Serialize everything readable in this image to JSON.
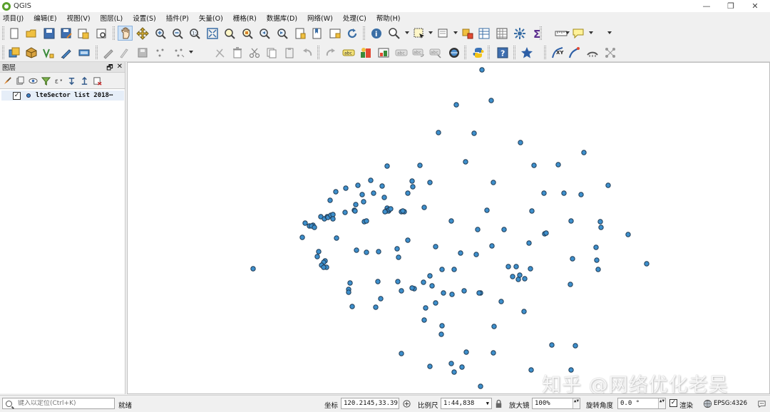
{
  "window": {
    "title": "QGIS",
    "controls": [
      "—",
      "❐",
      "✕"
    ]
  },
  "menubar": [
    "项目(J)",
    "编辑(E)",
    "视图(V)",
    "图层(L)",
    "设置(S)",
    "插件(P)",
    "矢量(O)",
    "栅格(R)",
    "数据库(D)",
    "网络(W)",
    "处理(C)",
    "帮助(H)"
  ],
  "toolbar1": {
    "icons": [
      "new-project-icon",
      "open-project-icon",
      "save-project-icon",
      "save-as-icon",
      "print-layout-icon",
      "layout-manager-icon",
      "pan-icon",
      "pan-to-selection-icon",
      "zoom-in-icon",
      "zoom-out-icon",
      "zoom-native-icon",
      "zoom-full-icon",
      "zoom-to-selection-icon",
      "zoom-to-layer-icon",
      "zoom-last-icon",
      "zoom-next-icon",
      "new-bookmark-icon",
      "show-bookmarks-icon",
      "new-map-view-icon",
      "refresh-icon",
      "identify-icon",
      "select-by-location-icon",
      "select-features-icon",
      "deselect-icon",
      "open-attribute-table-icon",
      "field-calculator-icon",
      "processing-toolbox-icon",
      "statistics-icon",
      "measure-icon",
      "map-tips-icon",
      "text-annotation-icon"
    ]
  },
  "toolbar2": {
    "icons": [
      "data-source-manager-icon",
      "new-geopackage-icon",
      "new-shapefile-icon",
      "digitize-icon",
      "new-virtual-layer-icon",
      "current-edits-icon",
      "toggle-editing-icon",
      "save-edits-icon",
      "add-feature-icon",
      "vertex-tool-icon",
      "delete-selected-icon",
      "cut-features-icon",
      "copy-features-icon",
      "paste-features-icon",
      "undo-icon",
      "redo-icon",
      "label-toolbar-icon",
      "layer-diagram-icon",
      "pin-labels-icon",
      "highlight-labels-icon",
      "move-label-icon",
      "rotate-label-icon",
      "change-label-icon",
      "plugin-globe-icon",
      "python-console-icon",
      "help-icon",
      "favorites-star-icon",
      "xy-tool-icon",
      "curve-tool-icon",
      "ruler-icon",
      "topology-icon"
    ]
  },
  "layers_panel": {
    "title": "图层",
    "header_buttons": [
      "🗗",
      "✕"
    ],
    "tools": [
      "open-styling-icon",
      "add-group-icon",
      "manage-map-themes-icon",
      "filter-legend-icon",
      "filter-by-expression-icon",
      "expand-all-icon",
      "collapse-all-icon",
      "remove-layer-icon"
    ],
    "layers": [
      {
        "name": "lteSector list 2018⋯",
        "checked": true,
        "check_glyph": "✓",
        "symbol_color": "#3a86c8"
      }
    ]
  },
  "map": {
    "background": "#ffffff",
    "point_fill": "#3d8fcc",
    "point_stroke": "#1f3b55"
  },
  "watermark": "知乎 @网络优化老吴",
  "statusbar": {
    "locator_placeholder": "键入以定位(Ctrl+K)",
    "status_message": "就绪",
    "coordinate_label": "坐标",
    "coordinate_value": "120.2145,33.3917",
    "scale_label": "比例尺",
    "scale_value": "1:44,838",
    "magnifier_label": "放大镜",
    "magnifier_value": "100%",
    "rotation_label": "旋转角度",
    "rotation_value": "0.0 °",
    "render_label": "渲染",
    "render_checked": true,
    "render_glyph": "✓",
    "crs_label": "EPSG:4326",
    "spin_glyph": "▲▼"
  }
}
